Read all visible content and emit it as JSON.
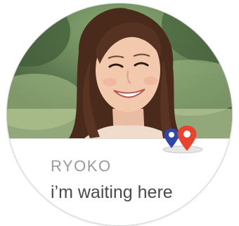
{
  "notification": {
    "contact_name": "RYOKO",
    "message": "i’m waiting here",
    "icon": "location-pin-icon",
    "pin_colors": {
      "back_pin": "#2f47a8",
      "front_pin": "#e8432c"
    }
  }
}
